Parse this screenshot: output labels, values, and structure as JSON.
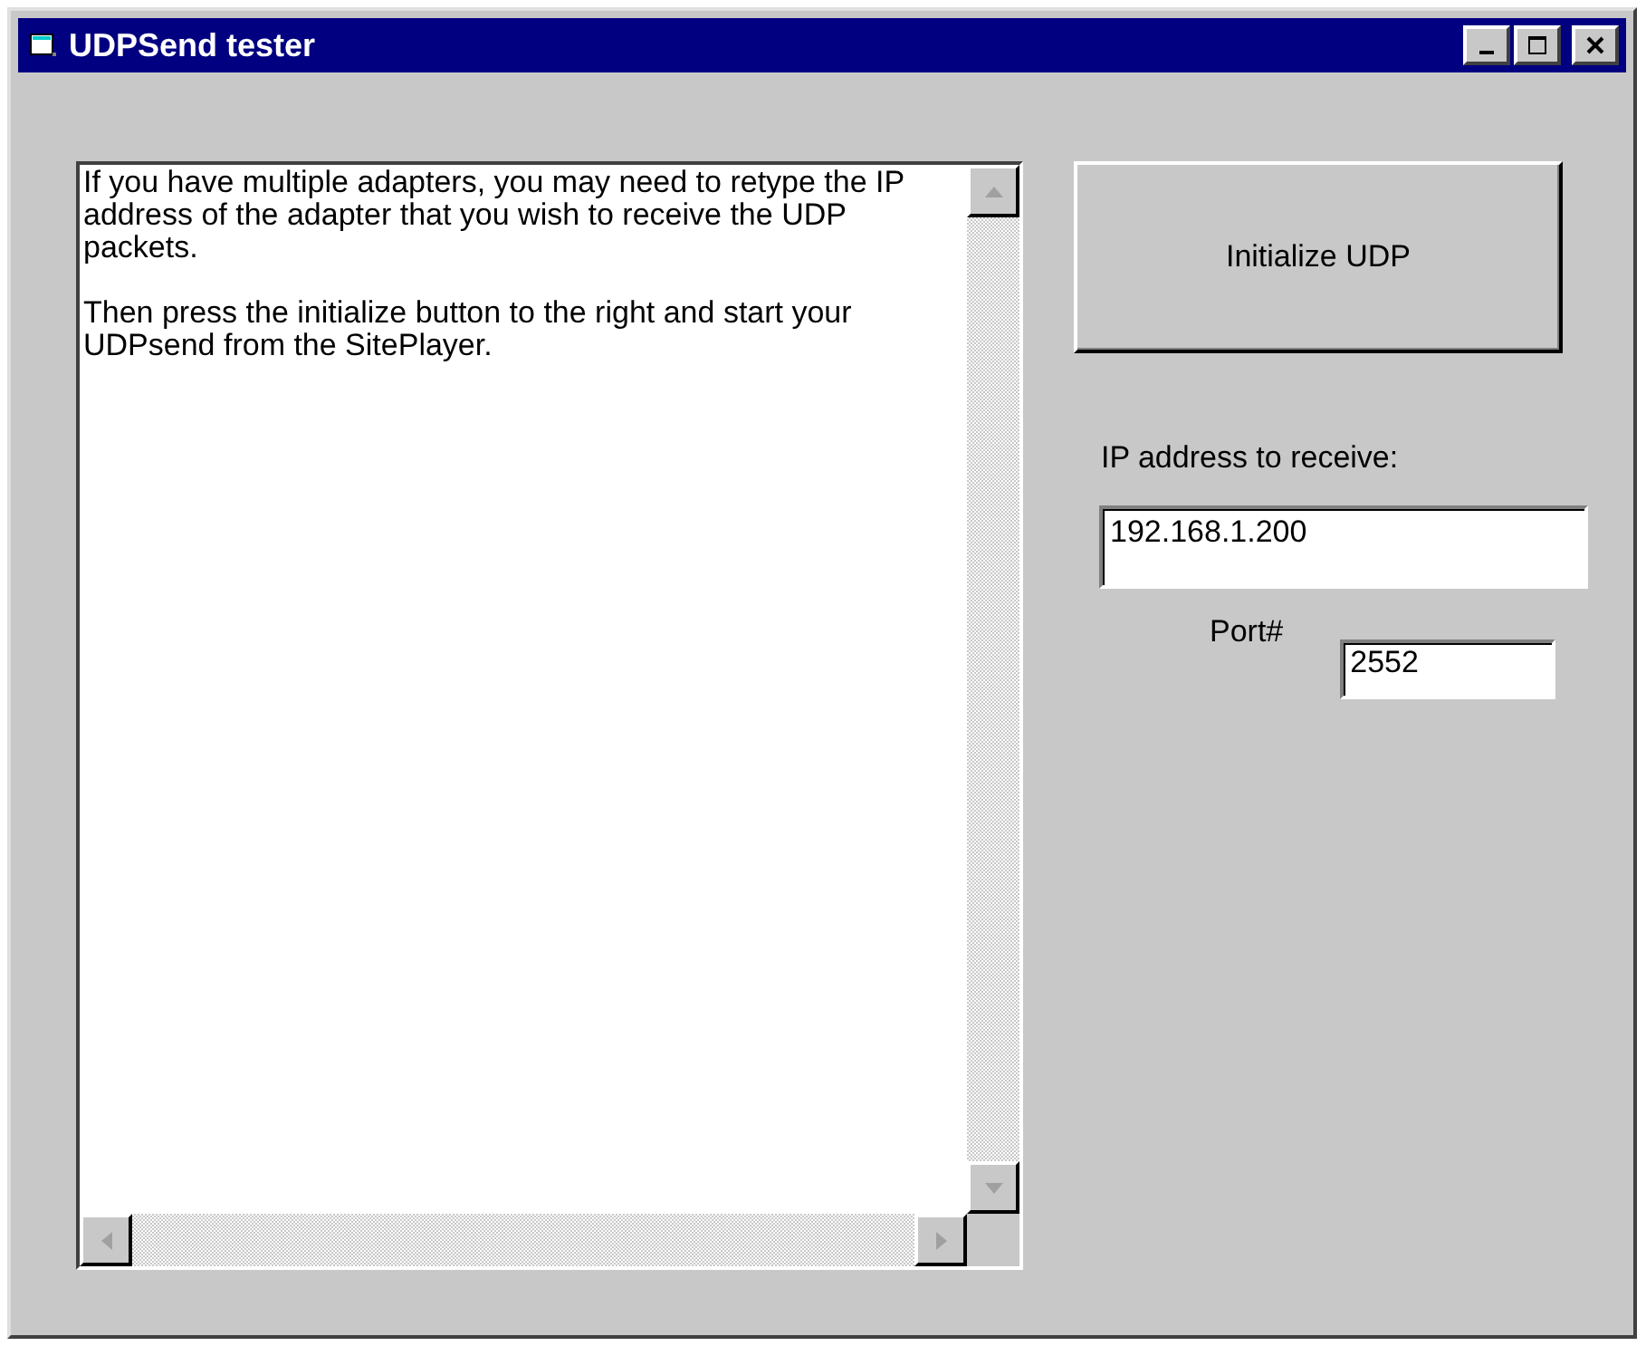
{
  "window": {
    "title": "UDPSend tester"
  },
  "message_box": {
    "paragraphs": [
      "If you have multiple adapters, you may need to retype the IP address of the adapter that you wish to receive the UDP packets.",
      "Then press the initialize button to the right and start your UDPsend from the SitePlayer."
    ]
  },
  "initialize_button": {
    "label": "Initialize UDP"
  },
  "ip_field": {
    "label": "IP address to receive:",
    "value": "192.168.1.200"
  },
  "port_field": {
    "label": "Port#",
    "value": "2552"
  }
}
